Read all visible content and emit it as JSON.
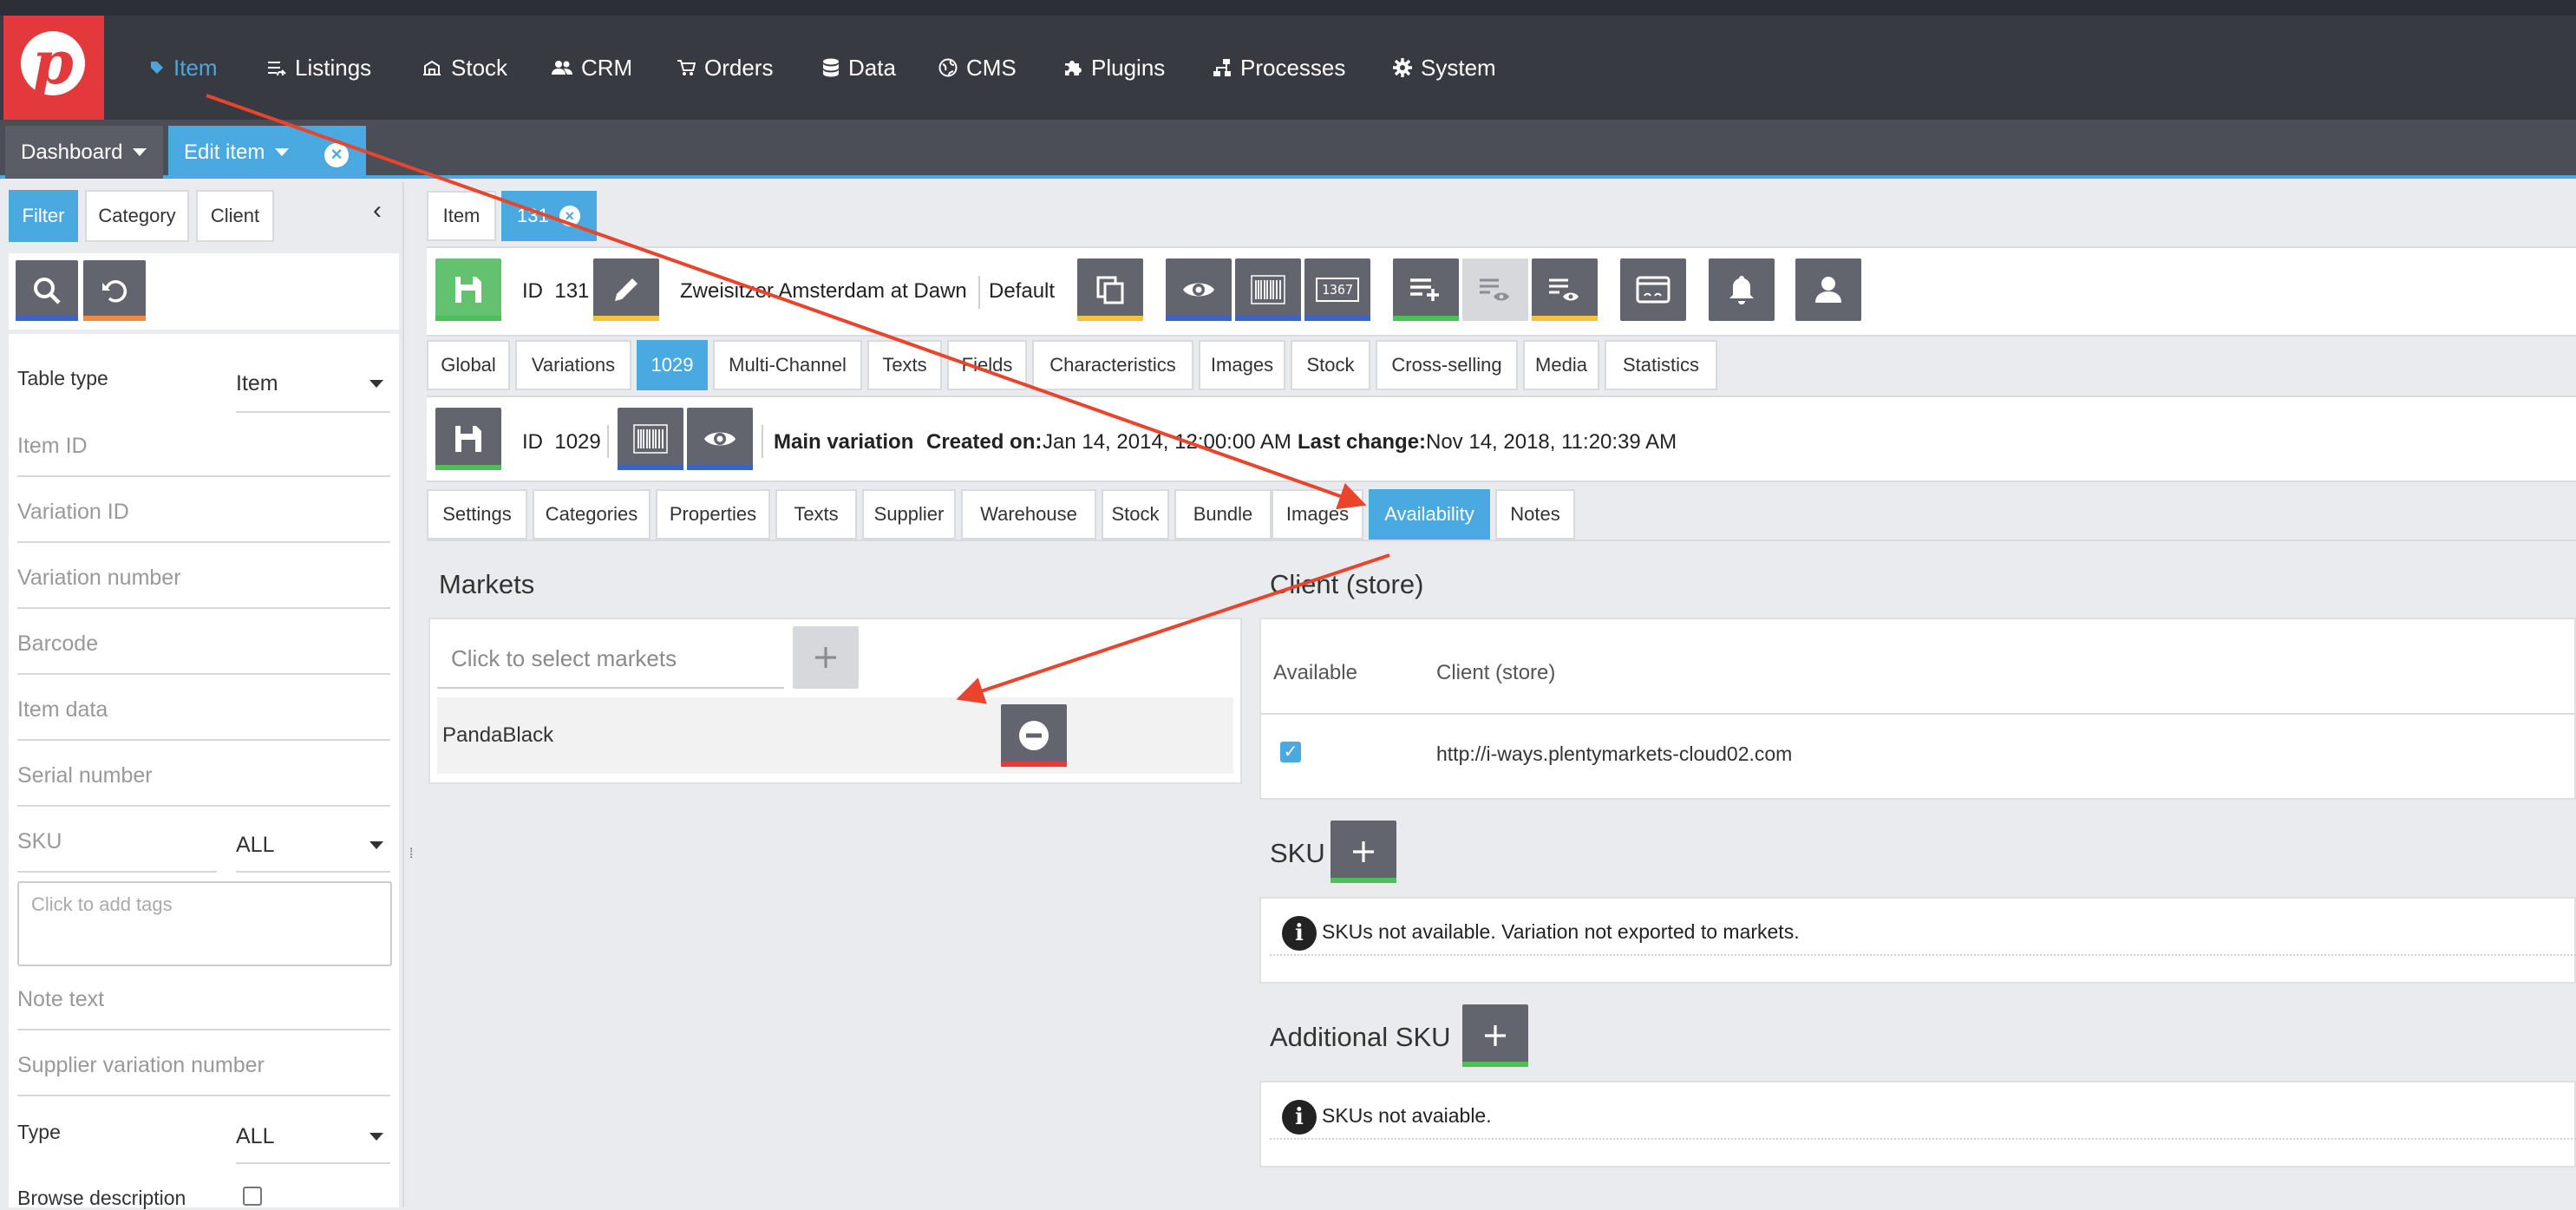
{
  "nav": {
    "items": [
      {
        "label": "Item",
        "icon": "tag-icon",
        "active": true
      },
      {
        "label": "Listings",
        "icon": "list-icon"
      },
      {
        "label": "Stock",
        "icon": "stock-icon"
      },
      {
        "label": "CRM",
        "icon": "people-icon"
      },
      {
        "label": "Orders",
        "icon": "cart-icon"
      },
      {
        "label": "Data",
        "icon": "database-icon"
      },
      {
        "label": "CMS",
        "icon": "globe-icon"
      },
      {
        "label": "Plugins",
        "icon": "puzzle-icon"
      },
      {
        "label": "Processes",
        "icon": "process-icon"
      },
      {
        "label": "System",
        "icon": "gear-icon"
      }
    ]
  },
  "window_tabs": [
    {
      "label": "Dashboard"
    },
    {
      "label": "Edit item",
      "active": true
    }
  ],
  "sidebar": {
    "tabs": [
      "Filter",
      "Category",
      "Client"
    ],
    "fields": {
      "table_type_label": "Table type",
      "table_type_value": "Item",
      "item_id": "Item ID",
      "variation_id": "Variation ID",
      "variation_number": "Variation number",
      "barcode": "Barcode",
      "item_data": "Item data",
      "serial_number": "Serial number",
      "sku_label": "SKU",
      "sku_value": "ALL",
      "tags_placeholder": "Click to add tags",
      "note_text": "Note text",
      "supplier_variation_number": "Supplier variation number",
      "type_label": "Type",
      "type_value": "ALL",
      "browse_description": "Browse description"
    }
  },
  "item_tabs": [
    {
      "label": "Item"
    },
    {
      "label": "131",
      "active": true
    }
  ],
  "item_toolbar": {
    "id_label": "ID",
    "id_value": "131",
    "name": "Zweisitzer Amsterdam at Dawn",
    "lang": "Default",
    "barcode_number": "1367"
  },
  "item_sections": [
    "Global",
    "Variations",
    "1029",
    "Multi-Channel",
    "Texts",
    "Fields",
    "Characteristics",
    "Images",
    "Stock",
    "Cross-selling",
    "Media",
    "Statistics"
  ],
  "variation_toolbar": {
    "id_label": "ID",
    "id_value": "1029",
    "main_variation": "Main variation",
    "created_label": "Created on:",
    "created_value": "Jan 14, 2014, 12:00:00 AM",
    "change_label": "Last change:",
    "change_value": "Nov 14, 2018, 11:20:39 AM"
  },
  "variation_sections": [
    "Settings",
    "Categories",
    "Properties",
    "Texts",
    "Supplier",
    "Warehouse",
    "Stock",
    "Bundle",
    "Images",
    "Availability",
    "Notes"
  ],
  "markets": {
    "title": "Markets",
    "placeholder": "Click to select markets",
    "rows": [
      {
        "name": "PandaBlack"
      }
    ]
  },
  "client_store": {
    "title": "Client (store)",
    "col_available": "Available",
    "col_client": "Client (store)",
    "rows": [
      {
        "available": true,
        "url": "http://i-ways.plentymarkets-cloud02.com"
      }
    ]
  },
  "sku": {
    "title": "SKU",
    "message": "SKUs not available. Variation not exported to markets."
  },
  "additional_sku": {
    "title": "Additional SKU",
    "message": "SKUs not avaiable."
  },
  "colors": {
    "accent": "#4aa9e0",
    "nav_bg": "#373a41",
    "logo_red": "#e4393c",
    "annotation_arrow": "#e8452c"
  }
}
